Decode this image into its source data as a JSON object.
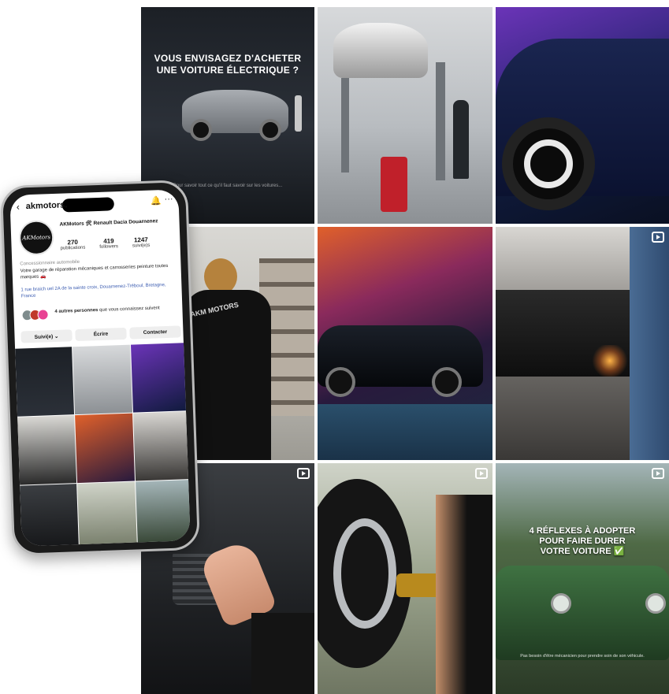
{
  "grid": {
    "tile1": {
      "title_line1": "VOUS ENVISAGEZ D'ACHETER",
      "title_line2": "UNE VOITURE ÉLECTRIQUE ?",
      "caption": "Pour savoir tout ce qu'il faut savoir sur les voitures..."
    },
    "tile4": {
      "shirt_print": "AKM MOTORS"
    },
    "tile9": {
      "title_line1": "4 RÉFLEXES À ADOPTER",
      "title_line2": "POUR FAIRE DURER",
      "title_line3": "VOTRE VOITURE ✅",
      "caption": "Pas besoin d'être mécanicien pour prendre soin de son véhicule."
    }
  },
  "profile": {
    "username": "akmotors.",
    "avatar_text": "AKMotors",
    "display_name": "AKMotors 🛠 Renault Dacia Douarnenez",
    "stats": [
      {
        "value": "270",
        "label": "publications"
      },
      {
        "value": "419",
        "label": "followers"
      },
      {
        "value": "1247",
        "label": "suivi(e)s"
      }
    ],
    "category": "Concessionnaire automobile",
    "bio": "Votre garage de réparation mécaniques et carrosseries peinture toutes marques 🚗",
    "address": "1 rue braich uel 2A de la sainte croix, Douarnenez-Tréboul, Bretagne, France",
    "followers_bold": "4 autres personnes",
    "followers_rest": " que vous connaissez suivent",
    "buttons": {
      "follow": "Suivi(e) ⌄",
      "message": "Écrire",
      "contact": "Contacter"
    }
  },
  "colors": {
    "link": "#3a5bb0",
    "purple_bg": "#6b34b8",
    "green_car": "#2f5a33"
  }
}
